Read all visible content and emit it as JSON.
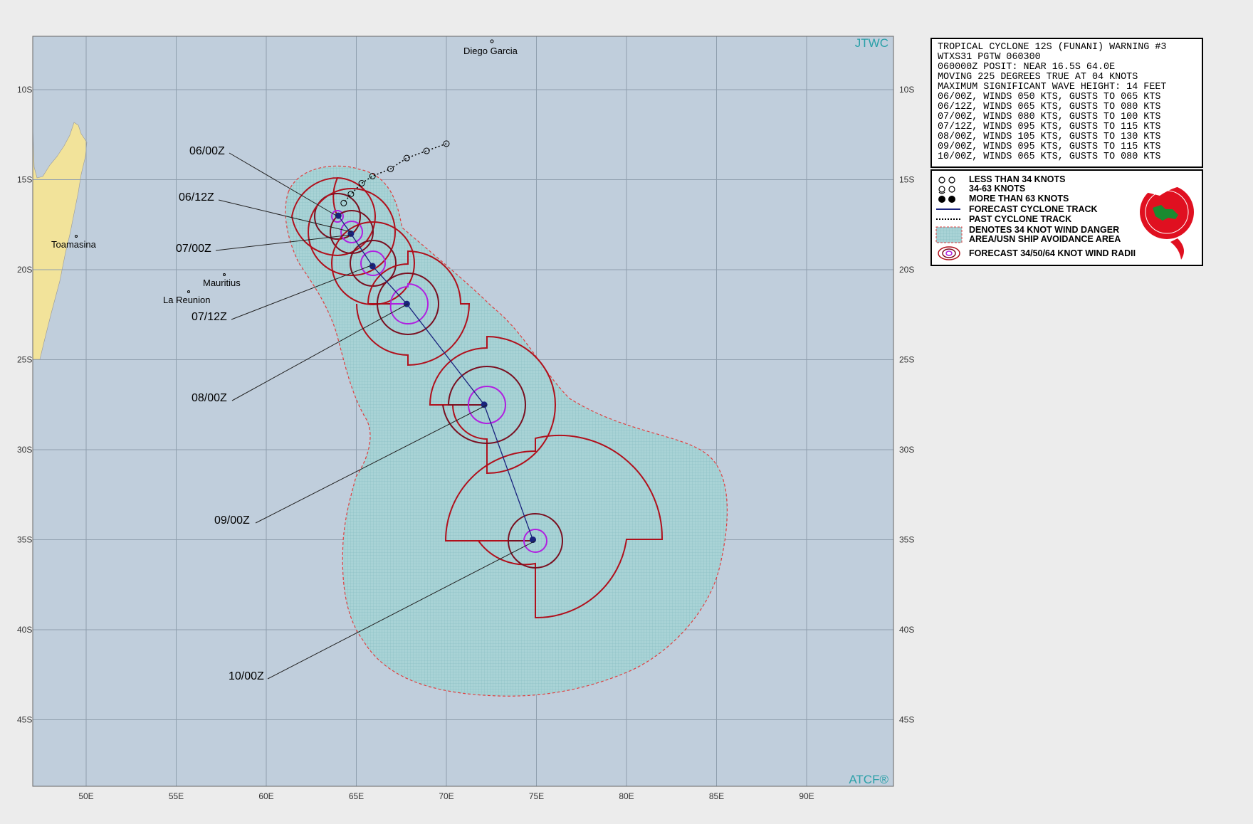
{
  "agency_top": "JTWC",
  "agency_bottom": "ATCF®",
  "lon_labels": [
    "50E",
    "55E",
    "60E",
    "65E",
    "70E",
    "75E",
    "80E",
    "85E",
    "90E"
  ],
  "lat_labels": [
    "10S",
    "15S",
    "20S",
    "25S",
    "30S",
    "35S",
    "40S",
    "45S"
  ],
  "places": {
    "diego_garcia": "Diego Garcia",
    "toamasina": "Toamasina",
    "mauritius": "Mauritius",
    "la_reunion": "La Reunion"
  },
  "warning": {
    "lines": [
      "TROPICAL CYCLONE 12S (FUNANI) WARNING #3",
      "WTXS31 PGTW 060300",
      "060000Z POSIT: NEAR 16.5S 64.0E",
      "MOVING 225 DEGREES TRUE AT 04 KNOTS",
      "MAXIMUM SIGNIFICANT WAVE HEIGHT: 14 FEET",
      "06/00Z, WINDS 050 KTS, GUSTS TO 065 KTS",
      "06/12Z, WINDS 065 KTS, GUSTS TO 080 KTS",
      "07/00Z, WINDS 080 KTS, GUSTS TO 100 KTS",
      "07/12Z, WINDS 095 KTS, GUSTS TO 115 KTS",
      "08/00Z, WINDS 105 KTS, GUSTS TO 130 KTS",
      "09/00Z, WINDS 095 KTS, GUSTS TO 115 KTS",
      "10/00Z, WINDS 065 KTS, GUSTS TO 080 KTS"
    ]
  },
  "legend": {
    "less34": "LESS THAN 34 KNOTS",
    "k34_63": "34-63 KNOTS",
    "more63": "MORE THAN 63 KNOTS",
    "forecast_track": "FORECAST CYCLONE TRACK",
    "past_track": "PAST CYCLONE TRACK",
    "danger_line1": "DENOTES 34 KNOT WIND DANGER",
    "danger_line2": "AREA/USN SHIP AVOIDANCE AREA",
    "radii": "FORECAST 34/50/64 KNOT WIND RADII"
  },
  "forecast_points": [
    {
      "label": "06/00Z",
      "lat": -17.0,
      "lon": 64.0
    },
    {
      "label": "06/12Z",
      "lat": -18.0,
      "lon": 64.7
    },
    {
      "label": "07/00Z",
      "lat": -19.8,
      "lon": 65.9
    },
    {
      "label": "07/12Z",
      "lat": -21.9,
      "lon": 67.8
    },
    {
      "label": "08/00Z",
      "lat": -27.5,
      "lon": 72.1
    },
    {
      "label": "09/00Z",
      "lat": -35.0,
      "lon": 74.8
    },
    {
      "label": "10/00Z",
      "lat": -35.0,
      "lon": 74.8
    }
  ],
  "timestamp_labels": [
    "06/00Z",
    "06/12Z",
    "07/00Z",
    "07/12Z",
    "08/00Z",
    "09/00Z",
    "10/00Z"
  ],
  "past_track": [
    {
      "lat": -13.0,
      "lon": 70.0
    },
    {
      "lat": -13.4,
      "lon": 68.9
    },
    {
      "lat": -13.8,
      "lon": 67.8
    },
    {
      "lat": -14.4,
      "lon": 66.9
    },
    {
      "lat": -14.8,
      "lon": 65.9
    },
    {
      "lat": -15.2,
      "lon": 65.3
    },
    {
      "lat": -15.8,
      "lon": 64.7
    },
    {
      "lat": -16.3,
      "lon": 64.3
    }
  ],
  "colors": {
    "ocean": "#c0cedc",
    "land": "#f2e39a",
    "danger_area": "#a9d3d6",
    "radii_34": "#b0101c",
    "radii_50": "#7a0f20",
    "radii_64": "#b020e0",
    "track": "#1a237e",
    "agency_text": "#2aa0a8"
  }
}
